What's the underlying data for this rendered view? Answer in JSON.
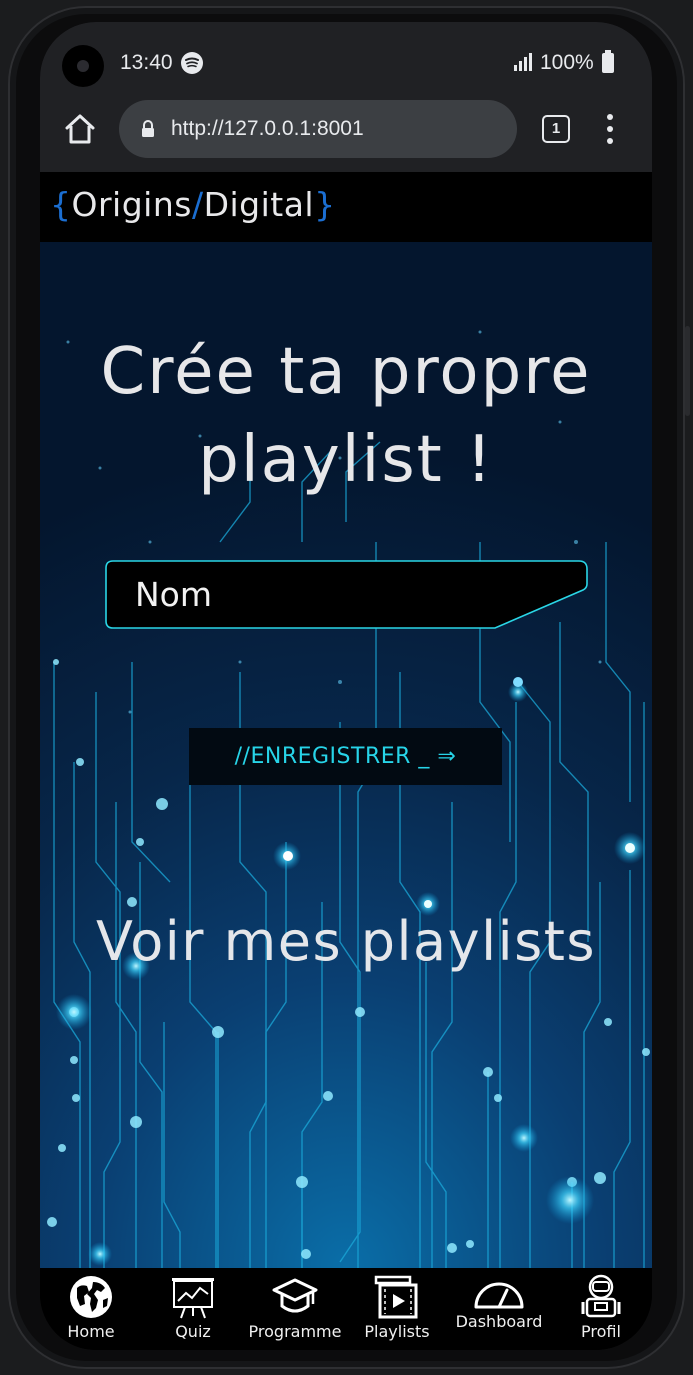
{
  "status_bar": {
    "time": "13:40",
    "battery": "100%",
    "music_app_icon": "spotify-icon",
    "signal_icon": "signal-icon"
  },
  "browser": {
    "url": "http://127.0.0.1:8001",
    "tab_count": "1",
    "home_icon": "home-icon",
    "lock_icon": "lock-icon",
    "menu_icon": "kebab-menu-icon"
  },
  "header": {
    "logo": {
      "brace_open": "{",
      "part1": "Origins",
      "slash": "/",
      "part2": "Digital",
      "brace_close": "}"
    },
    "accent_color": "#1b6ed1"
  },
  "main": {
    "title_line1": "Crée ta propre",
    "title_line2": "playlist !",
    "name_placeholder": "Nom",
    "save_button": "//ENREGISTRER _ ⇒",
    "my_playlists_heading": "Voir mes playlists",
    "accent_color": "#27d4e8"
  },
  "nav": {
    "items": [
      {
        "label": "Home",
        "icon": "globe-icon"
      },
      {
        "label": "Quiz",
        "icon": "presentation-chart-icon"
      },
      {
        "label": "Programme",
        "icon": "graduation-cap-icon"
      },
      {
        "label": "Playlists",
        "icon": "video-playlist-icon"
      },
      {
        "label": "Dashboard",
        "icon": "gauge-icon"
      },
      {
        "label": "Profil",
        "icon": "robot-icon"
      }
    ]
  }
}
